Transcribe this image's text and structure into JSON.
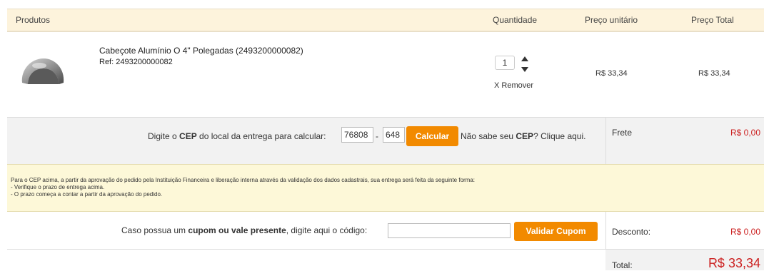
{
  "headers": {
    "products": "Produtos",
    "quantity": "Quantidade",
    "unit_price": "Preço unitário",
    "total_price": "Preço Total"
  },
  "product": {
    "name": "Cabeçote Alumínio O 4\" Polegadas (2493200000082)",
    "ref": "Ref: 2493200000082",
    "quantity": "1",
    "unit_price": "R$ 33,34",
    "total_price": "R$ 33,34",
    "remove_label": "X Remover"
  },
  "shipping": {
    "prompt_prefix": "Digite o ",
    "prompt_bold": "CEP",
    "prompt_suffix": " do local da entrega para calcular:",
    "cep_part1": "76808",
    "dash": "-",
    "cep_part2": "648",
    "calc_button": "Calcular",
    "help_prefix": "Não sabe seu ",
    "help_bold": "CEP",
    "help_suffix": "? Clique aqui.",
    "frete_label": "Frete",
    "frete_value": "R$ 0,00"
  },
  "notice": {
    "line1": "Para o CEP acima, a partir da aprovação do pedido pela Instituição Financeira e liberação interna através da validação dos dados cadastrais, sua entrega será feita da seguinte forma:",
    "line2": "- Verifique o prazo de entrega acima.",
    "line3": "- O prazo começa a contar a partir da aprovação do pedido."
  },
  "coupon": {
    "prefix": "Caso possua um ",
    "bold": "cupom ou vale presente",
    "suffix": ", digite aqui o código:",
    "button": "Validar Cupom",
    "discount_label": "Desconto:",
    "discount_value": "R$ 0,00"
  },
  "totals": {
    "label": "Total:",
    "value": "R$ 33,34"
  },
  "colors": {
    "accent": "#f28a00",
    "price_red": "#cc2222",
    "header_bg": "#fdf3dc",
    "notice_bg": "#fdf8d8"
  }
}
